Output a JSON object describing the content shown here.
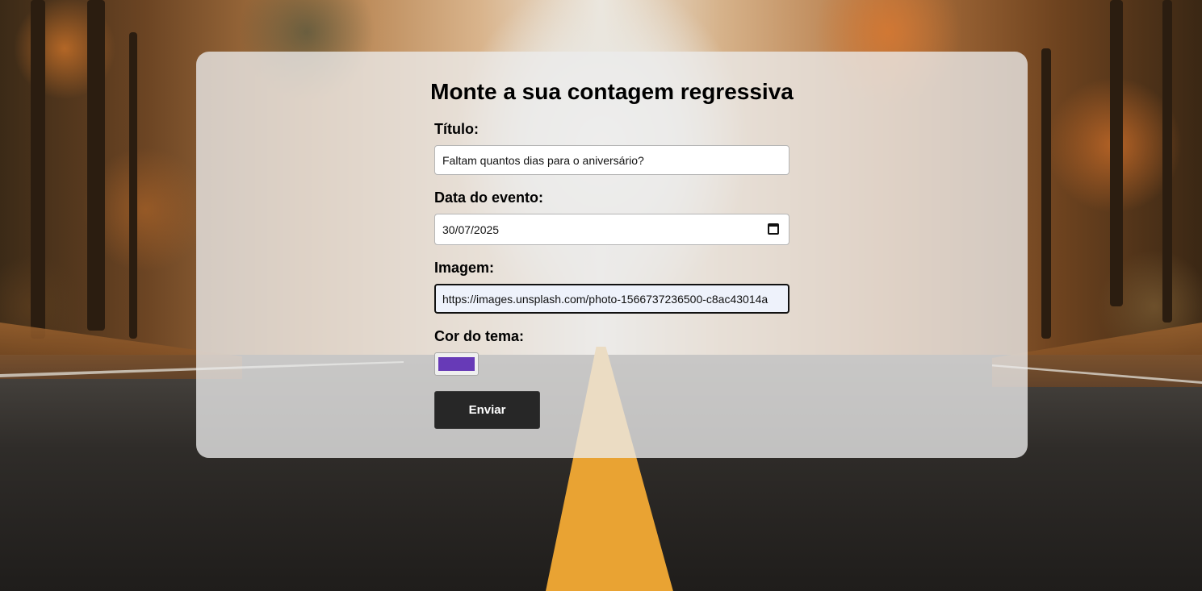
{
  "page": {
    "title": "Monte a sua contagem regressiva"
  },
  "form": {
    "title_label": "Título:",
    "title_value": "Faltam quantos dias para o aniversário?",
    "date_label": "Data do evento:",
    "date_value": "30/07/2025",
    "image_label": "Imagem:",
    "image_value": "https://images.unsplash.com/photo-1566737236500-c8ac43014a",
    "color_label": "Cor do tema:",
    "color_value": "#673ab7",
    "submit_label": "Enviar"
  },
  "icons": {
    "date_picker": "calendar-icon"
  }
}
